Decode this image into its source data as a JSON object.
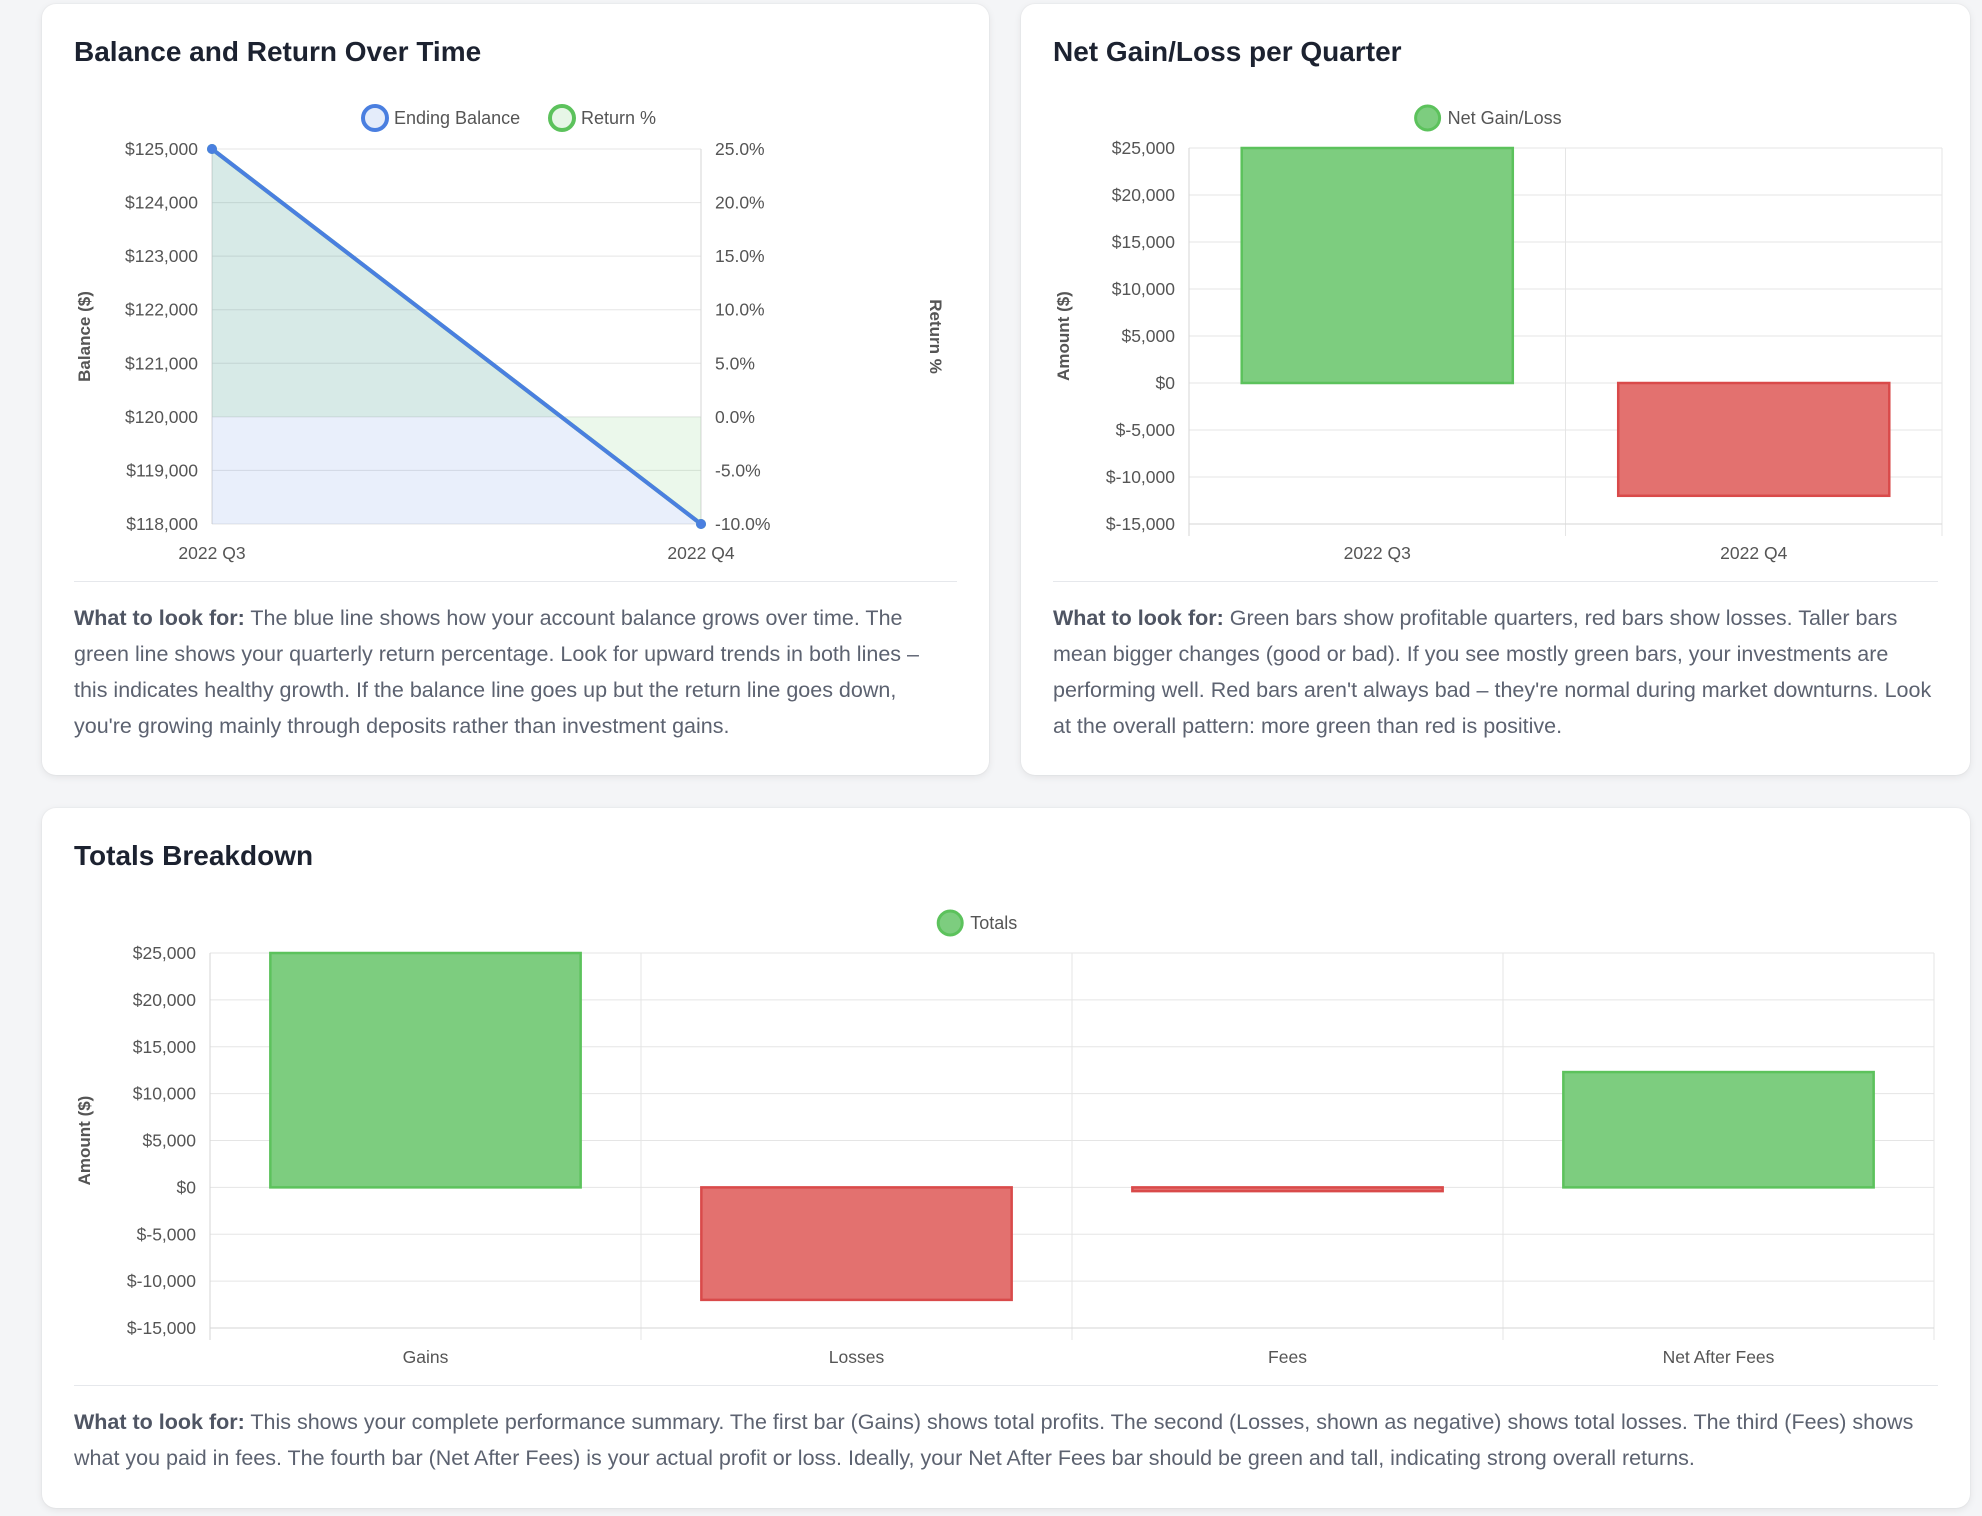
{
  "colors": {
    "blue": "#4a7fe0",
    "green": "#5cc25c",
    "green_fill": "#7dcd7f",
    "red": "#d94a4a",
    "red_fill": "#e3716f",
    "grid": "#e5e5e5",
    "axis_text": "#555555"
  },
  "cards": {
    "balance": {
      "title": "Balance and Return Over Time",
      "desc_lead": "What to look for:",
      "desc_body": " The blue line shows how your account balance grows over time. The green line shows your quarterly return percentage. Look for upward trends in both lines – this indicates healthy growth. If the balance line goes up but the return line goes down, you're growing mainly through deposits rather than investment gains."
    },
    "net": {
      "title": "Net Gain/Loss per Quarter",
      "desc_lead": "What to look for:",
      "desc_body": " Green bars show profitable quarters, red bars show losses. Taller bars mean bigger changes (good or bad). If you see mostly green bars, your investments are performing well. Red bars aren't always bad – they're normal during market downturns. Look at the overall pattern: more green than red is positive."
    },
    "totals": {
      "title": "Totals Breakdown",
      "desc_lead": "What to look for:",
      "desc_body": " This shows your complete performance summary. The first bar (Gains) shows total profits. The second (Losses, shown as negative) shows total losses. The third (Fees) shows what you paid in fees. The fourth bar (Net After Fees) is your actual profit or loss. Ideally, your Net After Fees bar should be green and tall, indicating strong overall returns."
    }
  },
  "chart_data": [
    {
      "type": "line",
      "title": "Balance and Return Over Time",
      "categories": [
        "2022 Q3",
        "2022 Q4"
      ],
      "series": [
        {
          "name": "Ending Balance",
          "axis": "left",
          "values": [
            125000,
            118000
          ]
        },
        {
          "name": "Return %",
          "axis": "right",
          "values": [
            25.0,
            -10.0
          ]
        }
      ],
      "ylabel": "Balance ($)",
      "y2label": "Return %",
      "ylim": [
        118000,
        125000
      ],
      "y2lim": [
        -10,
        25
      ],
      "y_ticks": [
        "$125,000",
        "$124,000",
        "$123,000",
        "$122,000",
        "$121,000",
        "$120,000",
        "$119,000",
        "$118,000"
      ],
      "y2_ticks": [
        "25.0%",
        "20.0%",
        "15.0%",
        "10.0%",
        "5.0%",
        "0.0%",
        "-5.0%",
        "-10.0%"
      ],
      "legend": "top-center",
      "grid": true
    },
    {
      "type": "bar",
      "title": "Net Gain/Loss per Quarter",
      "categories": [
        "2022 Q3",
        "2022 Q4"
      ],
      "series": [
        {
          "name": "Net Gain/Loss",
          "values": [
            25000,
            -12000
          ]
        }
      ],
      "ylabel": "Amount ($)",
      "ylim": [
        -15000,
        25000
      ],
      "y_ticks": [
        "$25,000",
        "$20,000",
        "$15,000",
        "$10,000",
        "$5,000",
        "$0",
        "$-5,000",
        "$-10,000",
        "$-15,000"
      ],
      "legend": "top-center",
      "grid": true
    },
    {
      "type": "bar",
      "title": "Totals Breakdown",
      "categories": [
        "Gains",
        "Losses",
        "Fees",
        "Net After Fees"
      ],
      "series": [
        {
          "name": "Totals",
          "values": [
            25000,
            -12000,
            -400,
            12300
          ]
        }
      ],
      "ylabel": "Amount ($)",
      "ylim": [
        -15000,
        25000
      ],
      "y_ticks": [
        "$25,000",
        "$20,000",
        "$15,000",
        "$10,000",
        "$5,000",
        "$0",
        "$-5,000",
        "$-10,000",
        "$-15,000"
      ],
      "legend": "top-center",
      "grid": true
    }
  ]
}
